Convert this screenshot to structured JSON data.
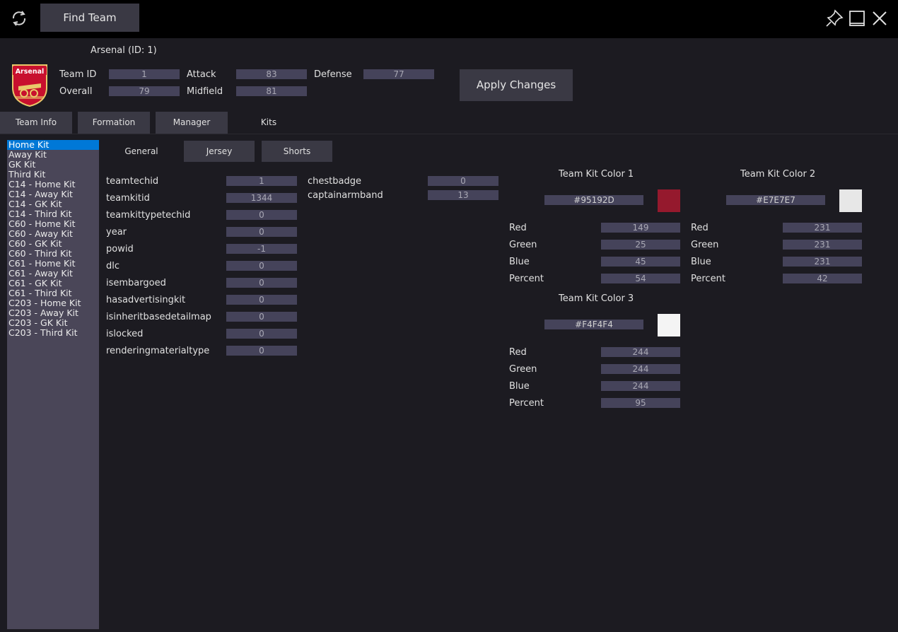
{
  "toolbar": {
    "find_team_label": "Find Team"
  },
  "team": {
    "title": "Arsenal (ID: 1)",
    "badge_text": "Arsenal",
    "stats": {
      "team_id": {
        "label": "Team ID",
        "value": "1"
      },
      "overall": {
        "label": "Overall",
        "value": "79"
      },
      "attack": {
        "label": "Attack",
        "value": "83"
      },
      "midfield": {
        "label": "Midfield",
        "value": "81"
      },
      "defense": {
        "label": "Defense",
        "value": "77"
      }
    },
    "apply_label": "Apply Changes"
  },
  "tabs": [
    "Team Info",
    "Formation",
    "Manager",
    "Kits"
  ],
  "active_tab": "Kits",
  "kits": {
    "list": [
      "Home Kit",
      "Away Kit",
      "GK Kit",
      "Third Kit",
      "C14 - Home Kit",
      "C14 - Away Kit",
      "C14 - GK Kit",
      "C14 - Third Kit",
      "C60 - Home Kit",
      "C60 - Away Kit",
      "C60 - GK Kit",
      "C60 - Third Kit",
      "C61 - Home Kit",
      "C61 - Away Kit",
      "C61 - GK Kit",
      "C61 - Third Kit",
      "C203 - Home Kit",
      "C203 - Away Kit",
      "C203 - GK Kit",
      "C203 - Third Kit"
    ],
    "selected": "Home Kit",
    "subtabs": [
      "General",
      "Jersey",
      "Shorts"
    ],
    "active_subtab": "General",
    "fields_left": [
      {
        "label": "teamtechid",
        "value": "1"
      },
      {
        "label": "teamkitid",
        "value": "1344"
      },
      {
        "label": "teamkittypetechid",
        "value": "0"
      },
      {
        "label": "year",
        "value": "0"
      },
      {
        "label": "powid",
        "value": "-1"
      },
      {
        "label": "dlc",
        "value": "0"
      },
      {
        "label": "isembargoed",
        "value": "0"
      },
      {
        "label": "hasadvertisingkit",
        "value": "0"
      },
      {
        "label": "isinheritbasedetailmap",
        "value": "0"
      },
      {
        "label": "islocked",
        "value": "0"
      },
      {
        "label": "renderingmaterialtype",
        "value": "0"
      }
    ],
    "fields_mid": [
      {
        "label": "chestbadge",
        "value": "0"
      },
      {
        "label": "captainarmband",
        "value": "13"
      }
    ],
    "colors": [
      {
        "title": "Team Kit Color 1",
        "hex": "#95192D",
        "swatch": "#95192D",
        "rows": [
          {
            "label": "Red",
            "value": "149"
          },
          {
            "label": "Green",
            "value": "25"
          },
          {
            "label": "Blue",
            "value": "45"
          },
          {
            "label": "Percent",
            "value": "54"
          }
        ]
      },
      {
        "title": "Team Kit Color 2",
        "hex": "#E7E7E7",
        "swatch": "#E7E7E7",
        "rows": [
          {
            "label": "Red",
            "value": "231"
          },
          {
            "label": "Green",
            "value": "231"
          },
          {
            "label": "Blue",
            "value": "231"
          },
          {
            "label": "Percent",
            "value": "42"
          }
        ]
      },
      {
        "title": "Team Kit Color 3",
        "hex": "#F4F4F4",
        "swatch": "#F4F4F4",
        "rows": [
          {
            "label": "Red",
            "value": "244"
          },
          {
            "label": "Green",
            "value": "244"
          },
          {
            "label": "Blue",
            "value": "244"
          },
          {
            "label": "Percent",
            "value": "95"
          }
        ]
      }
    ]
  },
  "icons": {
    "refresh": "refresh-icon",
    "pin": "pin-icon",
    "maximize": "maximize-icon",
    "close": "close-icon"
  }
}
